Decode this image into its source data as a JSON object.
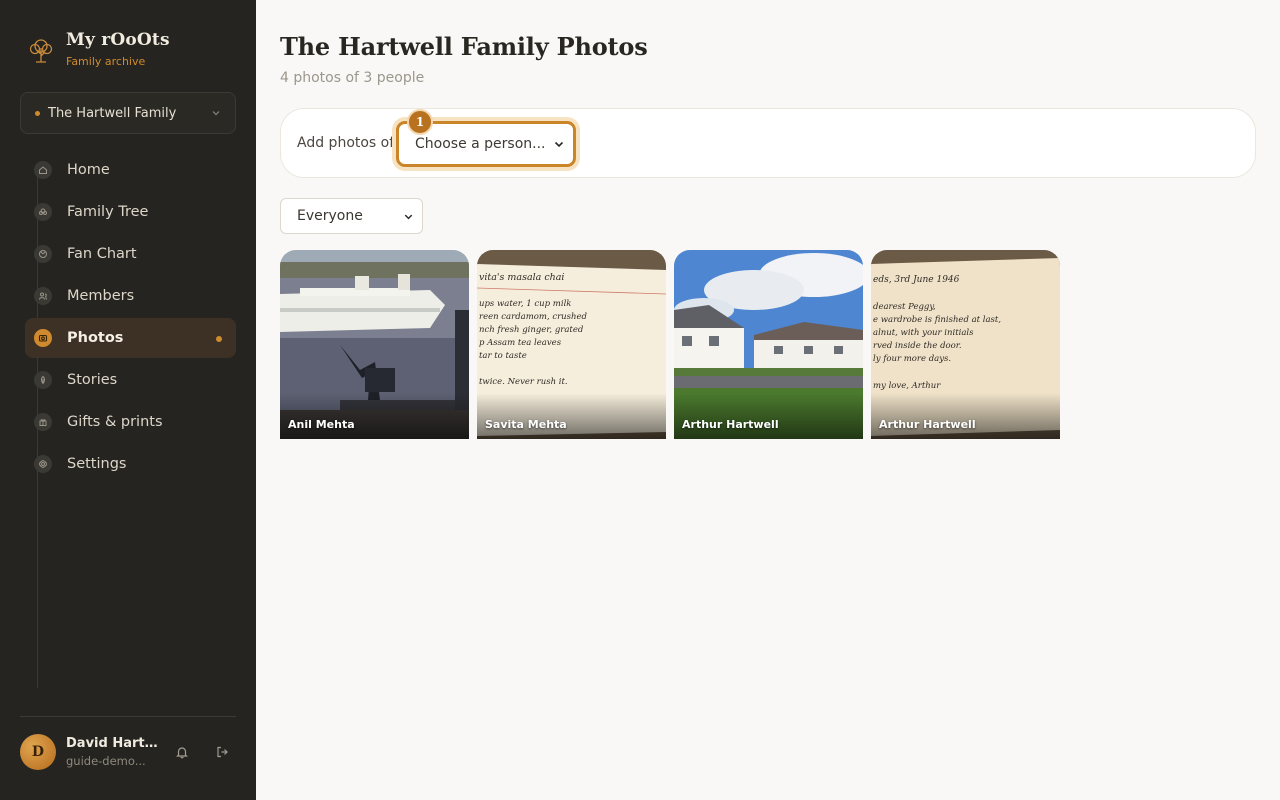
{
  "brand": {
    "name": "My rOoOts",
    "subtitle": "Family archive"
  },
  "family_switcher": {
    "selected": "The Hartwell Family"
  },
  "nav": [
    {
      "label": "Home",
      "icon": "home-icon"
    },
    {
      "label": "Family Tree",
      "icon": "tree-icon"
    },
    {
      "label": "Fan Chart",
      "icon": "fan-chart-icon"
    },
    {
      "label": "Members",
      "icon": "members-icon"
    },
    {
      "label": "Photos",
      "icon": "photos-icon",
      "active": true
    },
    {
      "label": "Stories",
      "icon": "stories-icon"
    },
    {
      "label": "Gifts & prints",
      "icon": "gift-icon"
    },
    {
      "label": "Settings",
      "icon": "settings-icon"
    }
  ],
  "user": {
    "initial": "D",
    "name": "David Hartwell",
    "email": "guide-demo..."
  },
  "page": {
    "title": "The Hartwell Family Photos",
    "subtitle": "4 photos of 3 people"
  },
  "add_photos": {
    "label": "Add photos of",
    "select_value": "Choose a person...",
    "step_badge": "1"
  },
  "filter": {
    "selected": "Everyone"
  },
  "photos": [
    {
      "person": "Anil Mehta",
      "scene": "ship-harbour"
    },
    {
      "person": "Savita Mehta",
      "scene": "recipe-note",
      "lines": [
        "vita's masala chai",
        "ups water, 1 cup milk",
        "reen cardamom, crushed",
        "nch fresh ginger, grated",
        "p Assam tea leaves",
        "tar to taste",
        "twice. Never rush it."
      ]
    },
    {
      "person": "Arthur Hartwell",
      "scene": "houses"
    },
    {
      "person": "Arthur Hartwell",
      "scene": "letter",
      "lines": [
        "eds, 3rd June 1946",
        "dearest Peggy,",
        "e wardrobe is finished at last,",
        "alnut, with your initials",
        "rved inside the door.",
        "ly four more days.",
        "my love, Arthur"
      ]
    }
  ],
  "colors": {
    "accent": "#d08a2e",
    "sidebar_bg": "#252420",
    "page_bg": "#f9f8f6"
  }
}
